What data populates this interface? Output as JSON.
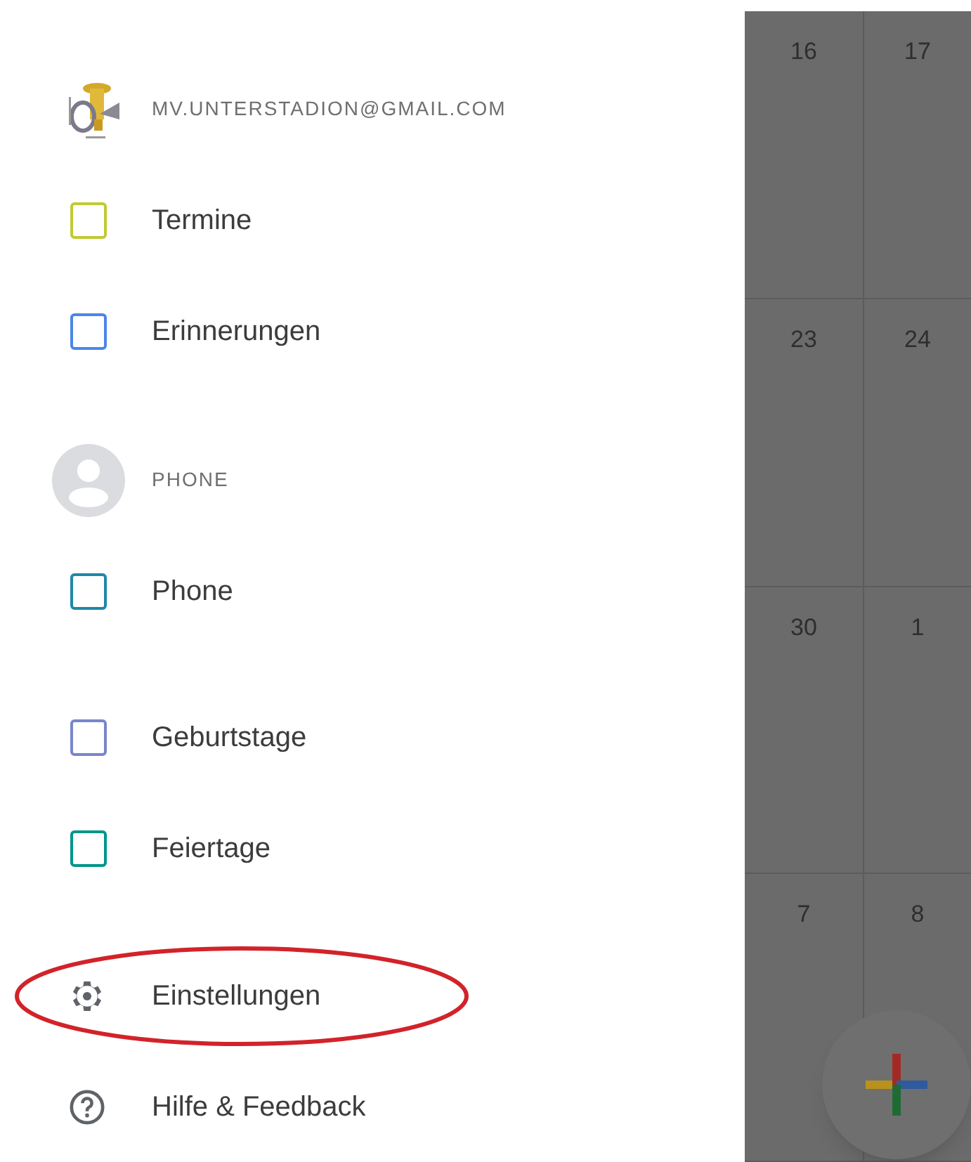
{
  "drawer": {
    "sections": [
      {
        "account": {
          "kind": "logo",
          "label": "MV.UNTERSTADION@GMAIL.COM"
        },
        "calendars": [
          {
            "name": "Termine",
            "color": "#c0ca33",
            "checked": false
          },
          {
            "name": "Erinnerungen",
            "color": "#4a86e8",
            "checked": false
          }
        ]
      },
      {
        "account": {
          "kind": "person",
          "label": "PHONE"
        },
        "calendars": [
          {
            "name": "Phone",
            "color": "#1e88a8",
            "checked": false
          }
        ]
      },
      {
        "calendars": [
          {
            "name": "Geburtstage",
            "color": "#7986cb",
            "checked": false
          },
          {
            "name": "Feiertage",
            "color": "#009688",
            "checked": false
          }
        ]
      }
    ],
    "menu": [
      {
        "kind": "settings",
        "label": "Einstellungen",
        "annotated": true
      },
      {
        "kind": "help",
        "label": "Hilfe & Feedback",
        "annotated": false
      }
    ]
  },
  "calendar": {
    "weeks": [
      [
        "16",
        "17"
      ],
      [
        "23",
        "24"
      ],
      [
        "30",
        "1"
      ],
      [
        "7",
        "8"
      ]
    ]
  }
}
